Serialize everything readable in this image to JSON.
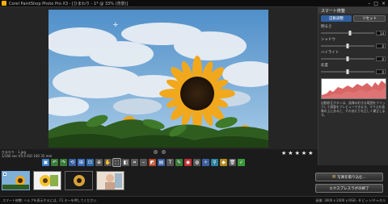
{
  "window": {
    "title": "Corel PaintShop Photo Pro X3 - [ひまわり - 1* @ 33% (背景)]",
    "min": "–",
    "max": "□",
    "close": "×"
  },
  "right_panel": {
    "title": "スマート修整",
    "primary_button": "自動調整",
    "secondary_button": "リセット",
    "sliders": [
      {
        "label": "明るさ",
        "value": "14",
        "level": 0.55
      },
      {
        "label": "シャドウ",
        "value": "0",
        "level": 0.5
      },
      {
        "label": "ハイライト",
        "value": "0",
        "level": 0.5
      },
      {
        "label": "彩度",
        "value": "0",
        "level": 0.5
      }
    ],
    "description": "自動修正ボタンは、画像の好きな範囲をクリックして調整をプレビューできます。マウスを画像の上にあると、そのあたりを正しく補正します。"
  },
  "info": {
    "line1": "ひまわり - 1.jpg",
    "line2": "1/160 sec f/5.6 ISO 100 35 mm"
  },
  "stars": [
    "★",
    "★",
    "★",
    "★",
    "★"
  ],
  "toolbar": {
    "tools": [
      {
        "name": "save-icon",
        "glyph": "▣",
        "color": "#3c7ec8"
      },
      {
        "name": "undo-icon",
        "glyph": "↶",
        "color": "#3a7d3a"
      },
      {
        "name": "redo-icon",
        "glyph": "↷",
        "color": "#3a7d3a"
      },
      {
        "name": "rotate-icon",
        "glyph": "⟲",
        "color": "#3a5fa0"
      },
      {
        "name": "grid-icon",
        "glyph": "⊞",
        "color": "#3c6db8"
      },
      {
        "name": "fit-icon",
        "glyph": "⊡",
        "color": "#2e6aa8"
      },
      {
        "name": "zoom-icon",
        "glyph": "⊕",
        "color": "#555"
      },
      {
        "name": "hand-icon",
        "glyph": "✋",
        "color": "#555"
      },
      {
        "name": "select-icon",
        "glyph": "⬚",
        "color": "#444"
      },
      {
        "name": "compare-icon",
        "glyph": "◧",
        "color": "#555"
      },
      {
        "name": "crop-icon",
        "glyph": "⌗",
        "color": "#555"
      },
      {
        "name": "straighten-icon",
        "glyph": "⎯",
        "color": "#555"
      },
      {
        "name": "color-icon",
        "glyph": "◩",
        "color": "#b84a2e"
      },
      {
        "name": "levels-icon",
        "glyph": "▤",
        "color": "#3a5fa0"
      },
      {
        "name": "text-icon",
        "glyph": "T",
        "color": "#555"
      },
      {
        "name": "brush-icon",
        "glyph": "✎",
        "color": "#3a7d3a"
      },
      {
        "name": "redeye-icon",
        "glyph": "◉",
        "color": "#c03030"
      },
      {
        "name": "clone-icon",
        "glyph": "◍",
        "color": "#555"
      },
      {
        "name": "makeover-icon",
        "glyph": "✧",
        "color": "#3a5fa0"
      },
      {
        "name": "dropper-icon",
        "glyph": "⚲",
        "color": "#2a7f9e"
      },
      {
        "name": "fill-icon",
        "glyph": "◆",
        "color": "#b08a20"
      },
      {
        "name": "trash-icon",
        "glyph": "🗑",
        "color": "#555"
      },
      {
        "name": "done-icon",
        "glyph": "✓",
        "color": "#3a9a3a"
      }
    ]
  },
  "side_buttons": {
    "copy_label": "写真を取り込む...",
    "express_label": "エクスプレスラボの終了"
  },
  "status": {
    "left": "スマート修整: ヘルプを表示するには、F1 キーを押してください",
    "right": "画像: 3600 x 2400 x RGB - 8 ビット/チャネル"
  }
}
